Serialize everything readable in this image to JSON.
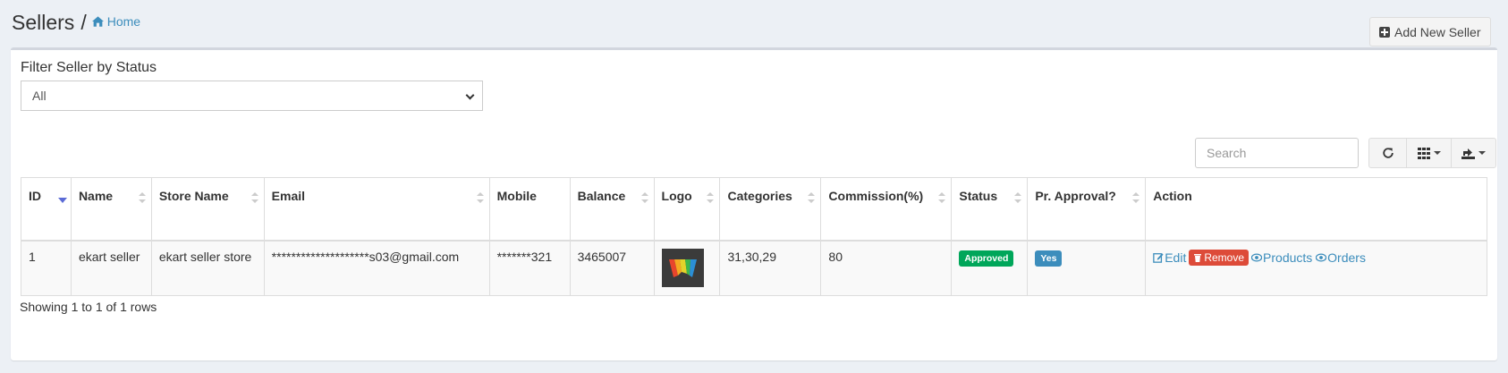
{
  "header": {
    "title": "Sellers",
    "separator": "/",
    "breadcrumb_home": "Home",
    "add_button": "Add New Seller"
  },
  "filter": {
    "label": "Filter Seller by Status",
    "selected": "All"
  },
  "toolbar": {
    "search_placeholder": "Search",
    "icons": [
      "refresh-icon",
      "columns-icon",
      "export-icon"
    ]
  },
  "table": {
    "columns": [
      "ID",
      "Name",
      "Store Name",
      "Email",
      "Mobile",
      "Balance",
      "Logo",
      "Categories",
      "Commission(%)",
      "Status",
      "Pr. Approval?",
      "Action"
    ],
    "rows": [
      {
        "id": "1",
        "name": "ekart seller",
        "store_name": "ekart seller store",
        "email": "********************s03@gmail.com",
        "mobile": "*******321",
        "balance": "3465007",
        "categories": "31,30,29",
        "commission": "80",
        "status": "Approved",
        "approval": "Yes",
        "actions": {
          "edit": "Edit",
          "remove": "Remove",
          "products": "Products",
          "orders": "Orders"
        }
      }
    ]
  },
  "footer": {
    "showing": "Showing 1 to 1 of 1 rows"
  },
  "colors": {
    "link": "#3c8dbc",
    "approved": "#00a65a",
    "yes": "#3c8dbc",
    "remove": "#dd4b39",
    "page_bg": "#ecf0f5"
  }
}
